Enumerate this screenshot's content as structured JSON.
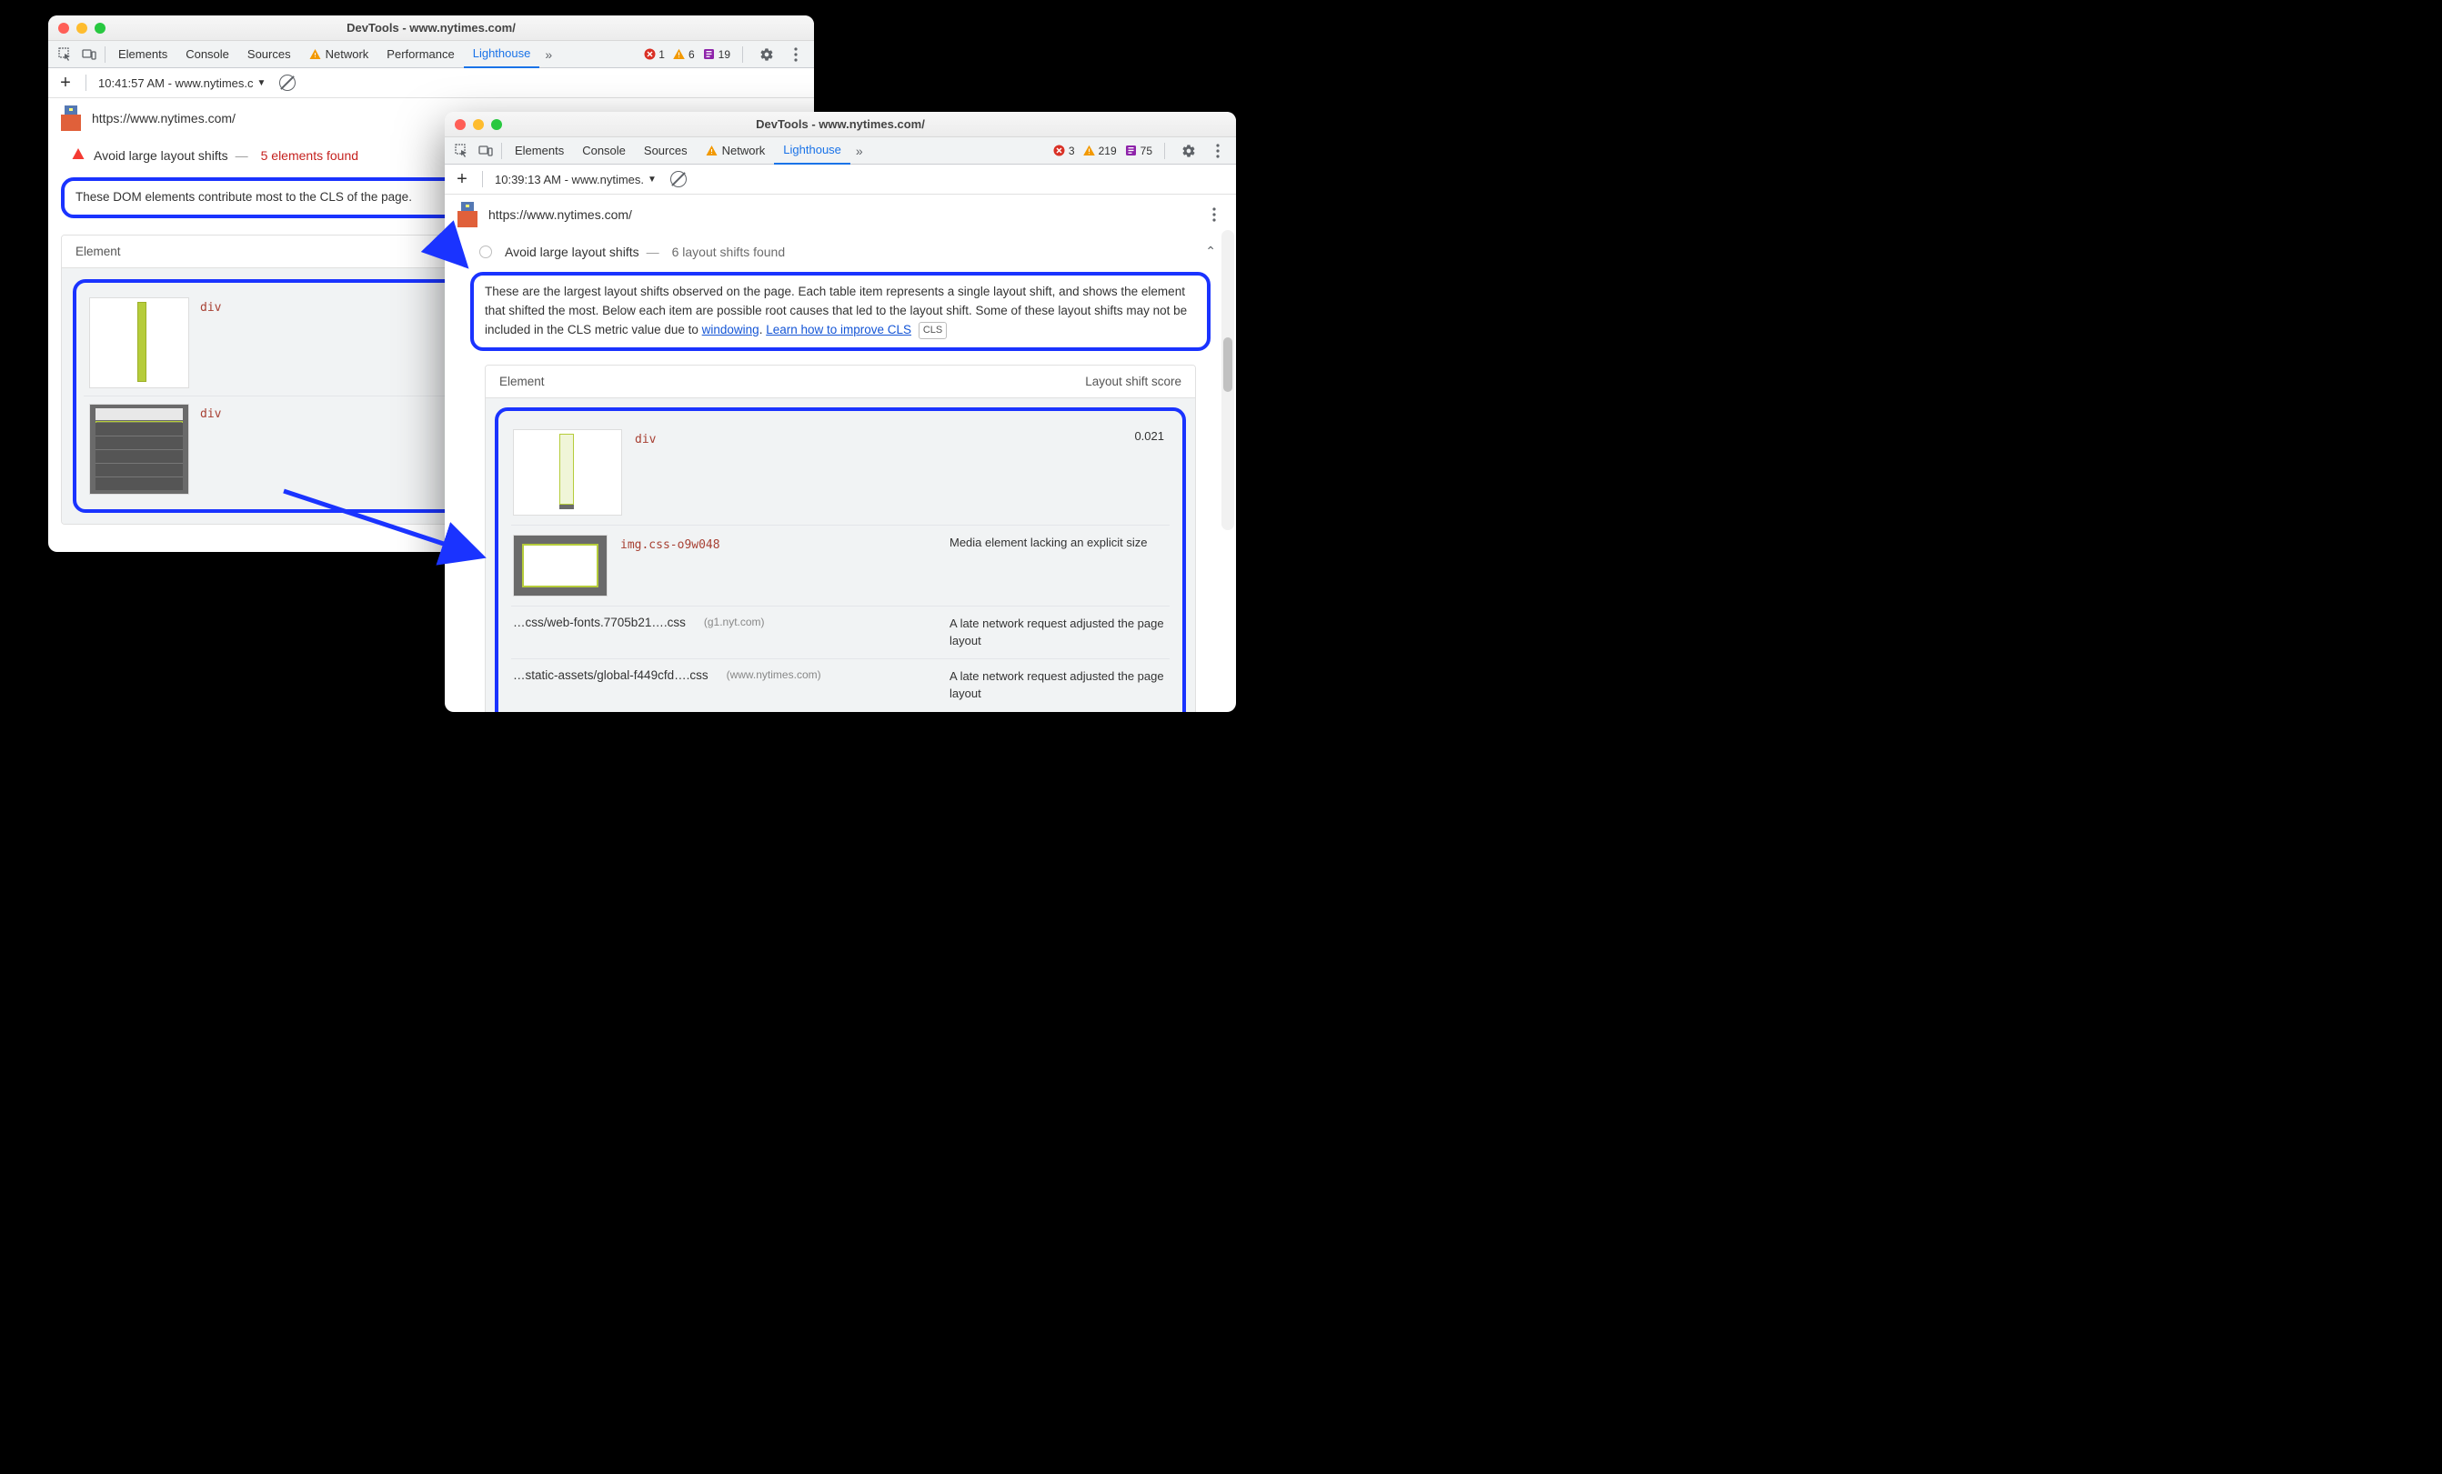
{
  "win_left": {
    "title": "DevTools - www.nytimes.com/",
    "tabs": {
      "elements": "Elements",
      "console": "Console",
      "sources": "Sources",
      "network": "Network",
      "performance": "Performance",
      "lighthouse": "Lighthouse"
    },
    "badges": {
      "errors": "1",
      "warnings": "6",
      "issues": "19"
    },
    "timestamp": "10:41:57 AM - www.nytimes.c",
    "url": "https://www.nytimes.com/",
    "audit": {
      "title": "Avoid large layout shifts",
      "found": "5 elements found",
      "desc": "These DOM elements contribute most to the CLS of the page.",
      "col_header": "Element",
      "items": [
        {
          "tag": "div"
        },
        {
          "tag": "div"
        }
      ]
    }
  },
  "win_right": {
    "title": "DevTools - www.nytimes.com/",
    "tabs": {
      "elements": "Elements",
      "console": "Console",
      "sources": "Sources",
      "network": "Network",
      "lighthouse": "Lighthouse"
    },
    "badges": {
      "errors": "3",
      "warnings": "219",
      "issues": "75"
    },
    "timestamp": "10:39:13 AM - www.nytimes.",
    "url": "https://www.nytimes.com/",
    "audit": {
      "title": "Avoid large layout shifts",
      "found": "6 layout shifts found",
      "desc_pre": "These are the largest layout shifts observed on the page. Each table item represents a single layout shift, and shows the element that shifted the most. Below each item are possible root causes that led to the layout shift. Some of these layout shifts may not be included in the CLS metric value due to ",
      "link1": "windowing",
      "link2": "Learn how to improve CLS",
      "cls_tag": "CLS",
      "col_element": "Element",
      "col_score": "Layout shift score",
      "items": {
        "div_tag": "div",
        "div_score": "0.021",
        "img_tag": "img.css-o9w048",
        "img_note": "Media element lacking an explicit size",
        "css1": "…css/web-fonts.7705b21….css",
        "css1_domain": "(g1.nyt.com)",
        "css1_note": "A late network request adjusted the page layout",
        "css2": "…static-assets/global-f449cfd….css",
        "css2_domain": "(www.nytimes.com)",
        "css2_note": "A late network request adjusted the page layout"
      }
    }
  }
}
